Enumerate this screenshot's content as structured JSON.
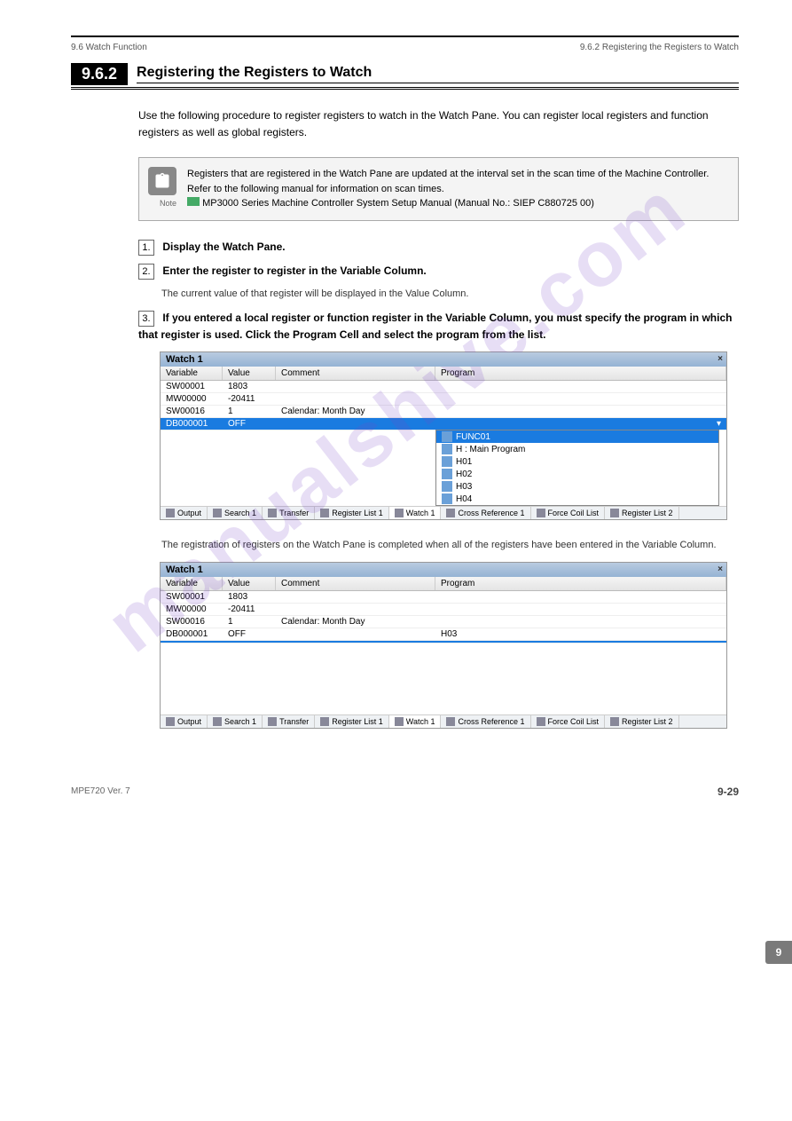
{
  "header": {
    "breadcrumb_left": "9.6 Watch Function",
    "breadcrumb_right": "9.6.2 Registering the Registers to Watch"
  },
  "section": {
    "number": "9.6.2",
    "title": "Registering the Registers to Watch"
  },
  "intro": "Use the following procedure to register registers to watch in the Watch Pane. You can register local registers and function registers as well as global registers.",
  "note": {
    "text": "Registers that are registered in the Watch Pane are updated at the interval set in the scan time of the Machine Controller. Refer to the following manual for information on scan times.",
    "ref_icon": "book-icon",
    "ref": "MP3000 Series Machine Controller System Setup Manual (Manual No.: SIEP C880725 00)",
    "label": "Note"
  },
  "steps": [
    {
      "num": "1.",
      "text": "Display the Watch Pane.",
      "body": ""
    },
    {
      "num": "2.",
      "text": "Enter the register to register in the Variable Column.",
      "body": "The current value of that register will be displayed in the Value Column."
    },
    {
      "num": "3.",
      "text": "If you entered a local register or function register in the Variable Column, you must specify the program in which that register is used. Click the Program Cell and select the program from the list.",
      "body": ""
    }
  ],
  "post_step3": "The registration of registers on the Watch Pane is completed when all of the registers have been entered in the Variable Column.",
  "screenshot1": {
    "title": "Watch 1",
    "columns": [
      "Variable",
      "Value",
      "Comment",
      "Program"
    ],
    "rows": [
      {
        "var": "SW00001",
        "val": "1803",
        "com": "",
        "prog": ""
      },
      {
        "var": "MW00000",
        "val": "-20411",
        "com": "",
        "prog": ""
      },
      {
        "var": "SW00016",
        "val": "1",
        "com": "Calendar: Month Day",
        "prog": ""
      },
      {
        "var": "DB000001",
        "val": "OFF",
        "com": "",
        "prog": "",
        "selected": true
      }
    ],
    "dropdown": [
      "FUNC01",
      "H : Main Program",
      "H01",
      "H02",
      "H03",
      "H04"
    ],
    "dropdown_selected": 0,
    "tabs": [
      "Output",
      "Search 1",
      "Transfer",
      "Register List 1",
      "Watch 1",
      "Cross Reference 1",
      "Force Coil List",
      "Register List 2"
    ],
    "active_tab": 4
  },
  "screenshot2": {
    "title": "Watch 1",
    "columns": [
      "Variable",
      "Value",
      "Comment",
      "Program"
    ],
    "rows": [
      {
        "var": "SW00001",
        "val": "1803",
        "com": "",
        "prog": ""
      },
      {
        "var": "MW00000",
        "val": "-20411",
        "com": "",
        "prog": ""
      },
      {
        "var": "SW00016",
        "val": "1",
        "com": "Calendar: Month Day",
        "prog": ""
      },
      {
        "var": "DB000001",
        "val": "OFF",
        "com": "",
        "prog": "H03"
      },
      {
        "var": "",
        "val": "",
        "com": "",
        "prog": "",
        "selected": true
      }
    ],
    "tabs": [
      "Output",
      "Search 1",
      "Transfer",
      "Register List 1",
      "Watch 1",
      "Cross Reference 1",
      "Force Coil List",
      "Register List 2"
    ],
    "active_tab": 4
  },
  "footer": {
    "book": "MPE720 Ver. 7",
    "pagenum": "9-29"
  },
  "side_tab": "9",
  "watermark": "manualshive.com"
}
